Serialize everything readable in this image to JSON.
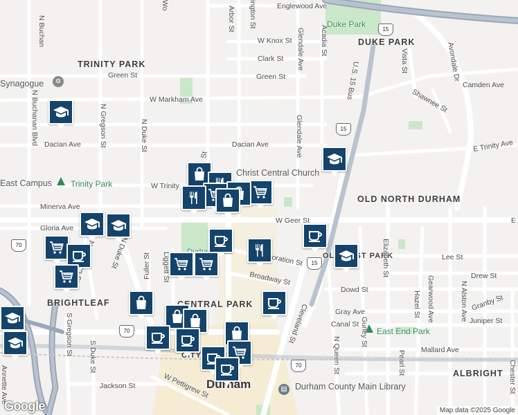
{
  "map": {
    "neighborhoods": [
      "TRINITY PARK",
      "DUKE PARK",
      "OLD NORTH DURHAM",
      "BRIGHTLEAF",
      "CENTRAL PARK",
      "ALBRIGHT",
      "OLD EAST PARK",
      "CITY"
    ],
    "city": "Durham",
    "parks": [
      "Duke Park",
      "Trinity Park",
      "East End Park",
      "Durham Park"
    ],
    "places": [
      "Christ Central Church",
      "Durham County Main Library",
      "Synagogue",
      "East Campus"
    ],
    "streets": {
      "englewood": "Englewood Ave",
      "knox": "W Knox St",
      "clark": "Clark St",
      "green": "Green St",
      "green2": "Green St",
      "markham": "W Markham Ave",
      "camden": "Camden Ave",
      "shawnee": "Shawnee St",
      "vista": "Vista St",
      "dacian": "Dacian Ave",
      "dacian2": "Dacian Ave",
      "trinity": "E Trinity Ave",
      "trinity_w": "W Trinity",
      "minerva": "Minerva Ave",
      "gloria": "Gloria Ave",
      "geer": "W Geer St",
      "geer_e": "E",
      "corporation": "W Corporation St",
      "broadway": "Broadway St",
      "dowd": "Dowd St",
      "lee": "Lee St",
      "drew": "Drew St",
      "gray": "Gray Ave",
      "canal": "Canal St",
      "juniper": "Juniper St",
      "granby": "Granby St",
      "mallard": "Mallard Ave",
      "jackson": "Jackson St",
      "pettigrew": "W Pettigrew St",
      "buchanan_blvd": "N Buchanan Blvd",
      "buchanan": "N Buchan",
      "gregson": "N Gregson St",
      "gregson_s": "S Gregson St",
      "duke": "N Duke St",
      "duke_n": "N Duke St",
      "duke_s": "S Duke St",
      "fuller": "Fuller St",
      "liggett": "Liggett St",
      "arbor": "Arbor St",
      "washington": "ington St",
      "glendale": "Glendale Ave",
      "glendale2": "Glendale Ave",
      "acadia": "Acadia St",
      "avondale": "Avondale Dr",
      "us15": "U.S. 15 Bus",
      "cleveland": "Cleveland St",
      "queen": "N Queen St",
      "elizabeth": "Elizabeth St",
      "hazel": "Hazel St",
      "gearwood": "Gearwood Ave",
      "alston": "N Alston Ave",
      "pearl": "Pearl St",
      "gurley": "Gurley St",
      "chester": "Chester St",
      "annette": "Annette Ave",
      "st": "St",
      "wo": "Wo"
    },
    "shields": [
      "15",
      "15",
      "15",
      "70",
      "70",
      "70"
    ],
    "markers": [
      {
        "type": "graduation-cap"
      },
      {
        "type": "shopping-bag"
      },
      {
        "type": "graduation-cap"
      },
      {
        "type": "restaurant"
      },
      {
        "type": "shopping-cart"
      },
      {
        "type": "shopping-cart"
      },
      {
        "type": "shopping-bag"
      },
      {
        "type": "restaurant"
      },
      {
        "type": "shopping-bag"
      },
      {
        "type": "graduation-cap"
      },
      {
        "type": "graduation-cap"
      },
      {
        "type": "shopping-cart"
      },
      {
        "type": "coffee"
      },
      {
        "type": "shopping-cart"
      },
      {
        "type": "coffee"
      },
      {
        "type": "restaurant"
      },
      {
        "type": "coffee"
      },
      {
        "type": "graduation-cap"
      },
      {
        "type": "shopping-cart"
      },
      {
        "type": "shopping-cart"
      },
      {
        "type": "shopping-bag"
      },
      {
        "type": "coffee"
      },
      {
        "type": "shopping-bag"
      },
      {
        "type": "shopping-bag"
      },
      {
        "type": "coffee"
      },
      {
        "type": "shopping-bag"
      },
      {
        "type": "coffee"
      },
      {
        "type": "coffee"
      },
      {
        "type": "shopping-cart"
      },
      {
        "type": "graduation-cap"
      },
      {
        "type": "graduation-cap"
      },
      {
        "type": "coffee"
      }
    ],
    "attribution": "Map data ©2025 Google",
    "logo": "Google",
    "colors": {
      "marker": "#14436b",
      "park": "#c8e6c9",
      "road": "#ffffff",
      "highway": "#9aa7b8",
      "downtown": "#f1e6c8"
    }
  }
}
